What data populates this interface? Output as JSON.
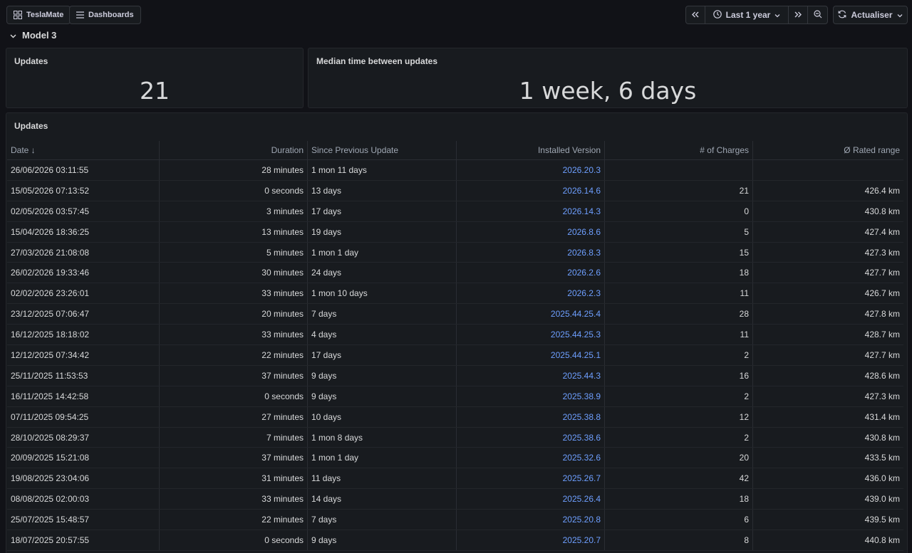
{
  "topbar": {
    "home_label": "TeslaMate",
    "dashboards_label": "Dashboards",
    "time_range": "Last 1 year",
    "refresh_label": "Actualiser"
  },
  "row": {
    "title": "Model 3"
  },
  "stats": {
    "updates": {
      "title": "Updates",
      "value": "21"
    },
    "median": {
      "title": "Median time between updates",
      "value": "1 week, 6 days"
    }
  },
  "table": {
    "title": "Updates",
    "columns": [
      "Date ↓",
      "Duration",
      "Since Previous Update",
      "Installed Version",
      "# of Charges",
      "Ø Rated range"
    ],
    "rows": [
      [
        "26/06/2026 03:11:55",
        "28 minutes",
        "1 mon 11 days",
        "2026.20.3",
        "",
        ""
      ],
      [
        "15/05/2026 07:13:52",
        "0 seconds",
        "13 days",
        "2026.14.6",
        "21",
        "426.4 km"
      ],
      [
        "02/05/2026 03:57:45",
        "3 minutes",
        "17 days",
        "2026.14.3",
        "0",
        "430.8 km"
      ],
      [
        "15/04/2026 18:36:25",
        "13 minutes",
        "19 days",
        "2026.8.6",
        "5",
        "427.4 km"
      ],
      [
        "27/03/2026 21:08:08",
        "5 minutes",
        "1 mon 1 day",
        "2026.8.3",
        "15",
        "427.3 km"
      ],
      [
        "26/02/2026 19:33:46",
        "30 minutes",
        "24 days",
        "2026.2.6",
        "18",
        "427.7 km"
      ],
      [
        "02/02/2026 23:26:01",
        "33 minutes",
        "1 mon 10 days",
        "2026.2.3",
        "11",
        "426.7 km"
      ],
      [
        "23/12/2025 07:06:47",
        "20 minutes",
        "7 days",
        "2025.44.25.4",
        "28",
        "427.8 km"
      ],
      [
        "16/12/2025 18:18:02",
        "33 minutes",
        "4 days",
        "2025.44.25.3",
        "11",
        "428.7 km"
      ],
      [
        "12/12/2025 07:34:42",
        "22 minutes",
        "17 days",
        "2025.44.25.1",
        "2",
        "427.7 km"
      ],
      [
        "25/11/2025 11:53:53",
        "37 minutes",
        "9 days",
        "2025.44.3",
        "16",
        "428.6 km"
      ],
      [
        "16/11/2025 14:42:58",
        "0 seconds",
        "9 days",
        "2025.38.9",
        "2",
        "427.3 km"
      ],
      [
        "07/11/2025 09:54:25",
        "27 minutes",
        "10 days",
        "2025.38.8",
        "12",
        "431.4 km"
      ],
      [
        "28/10/2025 08:29:37",
        "7 minutes",
        "1 mon 8 days",
        "2025.38.6",
        "2",
        "430.8 km"
      ],
      [
        "20/09/2025 15:21:08",
        "37 minutes",
        "1 mon 1 day",
        "2025.32.6",
        "20",
        "433.5 km"
      ],
      [
        "19/08/2025 23:04:06",
        "31 minutes",
        "11 days",
        "2025.26.7",
        "42",
        "436.0 km"
      ],
      [
        "08/08/2025 02:00:03",
        "33 minutes",
        "14 days",
        "2025.26.4",
        "18",
        "439.0 km"
      ],
      [
        "25/07/2025 15:48:57",
        "22 minutes",
        "7 days",
        "2025.20.8",
        "6",
        "439.5 km"
      ],
      [
        "18/07/2025 20:57:55",
        "0 seconds",
        "9 days",
        "2025.20.7",
        "8",
        "440.8 km"
      ]
    ]
  }
}
